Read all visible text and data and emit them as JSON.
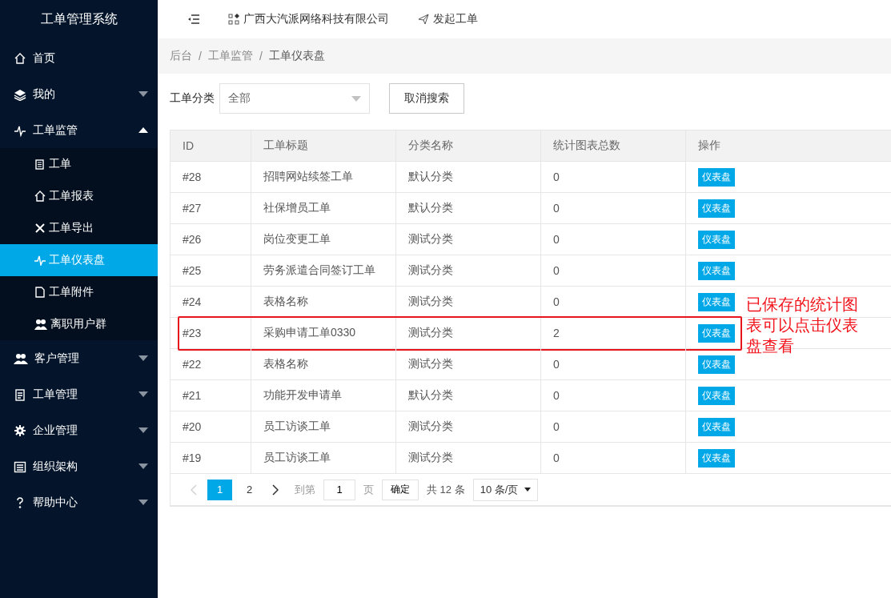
{
  "sidebar": {
    "title": "工单管理系统",
    "items": [
      {
        "label": "首页"
      },
      {
        "label": "我的",
        "expanded": false
      },
      {
        "label": "工单监管",
        "expanded": true,
        "children": [
          {
            "label": "工单",
            "selected": false
          },
          {
            "label": "工单报表",
            "selected": false
          },
          {
            "label": "工单导出",
            "selected": false
          },
          {
            "label": "工单仪表盘",
            "selected": true
          },
          {
            "label": "工单附件",
            "selected": false
          },
          {
            "label": "离职用户群",
            "selected": false
          }
        ]
      },
      {
        "label": "客户管理",
        "expanded": false
      },
      {
        "label": "工单管理",
        "expanded": false
      },
      {
        "label": "企业管理",
        "expanded": false
      },
      {
        "label": "组织架构",
        "expanded": false
      },
      {
        "label": "帮助中心",
        "expanded": false
      }
    ]
  },
  "topbar": {
    "company": "广西大汽派网络科技有限公司",
    "new_ticket": "发起工单"
  },
  "breadcrumb": {
    "separator": "/",
    "items": [
      "后台",
      "工单监管",
      "工单仪表盘"
    ]
  },
  "filter": {
    "label": "工单分类",
    "select_value": "全部",
    "cancel_button": "取消搜索"
  },
  "table": {
    "columns": [
      "ID",
      "工单标题",
      "分类名称",
      "统计图表总数",
      "操作"
    ],
    "rows": [
      {
        "id": "#28",
        "title": "招聘网站续签工单",
        "category": "默认分类",
        "count": "0",
        "action": "仪表盘",
        "highlighted": false
      },
      {
        "id": "#27",
        "title": "社保增员工单",
        "category": "默认分类",
        "count": "0",
        "action": "仪表盘",
        "highlighted": false
      },
      {
        "id": "#26",
        "title": "岗位变更工单",
        "category": "测试分类",
        "count": "0",
        "action": "仪表盘",
        "highlighted": false
      },
      {
        "id": "#25",
        "title": "劳务派遣合同签订工单",
        "category": "测试分类",
        "count": "0",
        "action": "仪表盘",
        "highlighted": false
      },
      {
        "id": "#24",
        "title": "表格名称",
        "category": "测试分类",
        "count": "0",
        "action": "仪表盘",
        "highlighted": false
      },
      {
        "id": "#23",
        "title": "采购申请工单0330",
        "category": "测试分类",
        "count": "2",
        "action": "仪表盘",
        "highlighted": true
      },
      {
        "id": "#22",
        "title": "表格名称",
        "category": "测试分类",
        "count": "0",
        "action": "仪表盘",
        "highlighted": false
      },
      {
        "id": "#21",
        "title": "功能开发申请单",
        "category": "默认分类",
        "count": "0",
        "action": "仪表盘",
        "highlighted": false
      },
      {
        "id": "#20",
        "title": "员工访谈工单",
        "category": "测试分类",
        "count": "0",
        "action": "仪表盘",
        "highlighted": false
      },
      {
        "id": "#19",
        "title": "员工访谈工单",
        "category": "测试分类",
        "count": "0",
        "action": "仪表盘",
        "highlighted": false
      }
    ]
  },
  "callout": {
    "text": "已保存的统计图表可以点击仪表盘查看"
  },
  "pagination": {
    "prev_disabled": true,
    "next_disabled": false,
    "pages": [
      {
        "label": "1",
        "selected": true
      },
      {
        "label": "2",
        "selected": false
      }
    ],
    "goto_label": "到第",
    "goto_value": "1",
    "page_unit": "页",
    "confirm": "确定",
    "total": "共 12 条",
    "page_size": "10 条/页"
  }
}
